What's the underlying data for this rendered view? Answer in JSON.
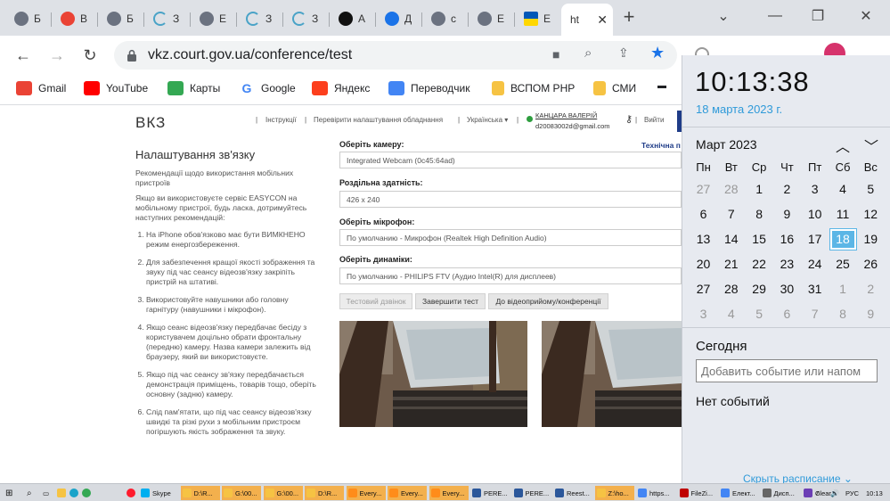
{
  "tabs": [
    {
      "title": "Б",
      "icon": "chrome-icon",
      "color": "#6b7280"
    },
    {
      "title": "В",
      "icon": "gmail-icon",
      "color": "#ea4335"
    },
    {
      "title": "Б",
      "icon": "chrome-icon",
      "color": "#6b7280"
    },
    {
      "title": "З",
      "icon": "loading-icon",
      "color": "#4aa3c7"
    },
    {
      "title": "Е",
      "icon": "chrome-icon",
      "color": "#6b7280"
    },
    {
      "title": "З",
      "icon": "loading-icon",
      "color": "#4aa3c7"
    },
    {
      "title": "З",
      "icon": "loading-icon",
      "color": "#4aa3c7"
    },
    {
      "title": "A",
      "icon": "font-icon",
      "color": "#111111"
    },
    {
      "title": "Д",
      "icon": "d-icon",
      "color": "#1a73e8"
    },
    {
      "title": "с",
      "icon": "chrome-icon",
      "color": "#6b7280"
    },
    {
      "title": "Е",
      "icon": "chrome-icon",
      "color": "#6b7280"
    },
    {
      "title": "Е",
      "icon": "ukraine-flag-icon",
      "color": "#ffd700"
    },
    {
      "title": "ht",
      "icon": "",
      "color": "#ffffff",
      "active": true
    }
  ],
  "address": {
    "url": "vkz.court.gov.ua/conference/test"
  },
  "bookmarks": [
    {
      "label": "Gmail",
      "icon": "gmail-icon",
      "color": "#ea4335"
    },
    {
      "label": "YouTube",
      "icon": "youtube-icon",
      "color": "#ff0000"
    },
    {
      "label": "Карты",
      "icon": "maps-icon",
      "color": "#34a853"
    },
    {
      "label": "Google",
      "icon": "google-icon",
      "color": "#4285f4"
    },
    {
      "label": "Яндекс",
      "icon": "yandex-icon",
      "color": "#fc3f1d"
    },
    {
      "label": "Переводчик",
      "icon": "translate-icon",
      "color": "#4285f4"
    },
    {
      "label": "ВСПОМ PHP",
      "icon": "folder-icon",
      "color": "#f6c343"
    },
    {
      "label": "СМИ",
      "icon": "folder-icon",
      "color": "#f6c343"
    }
  ],
  "site": {
    "logo": "ВКЗ",
    "nav": {
      "instructions": "Інструкції",
      "check_settings": "Перевірити налаштування обладнання",
      "language": "Українська",
      "user_name": "КАНЦАРА ВАЛЕРІЙ",
      "user_email": "d20083002d@gmail.com",
      "logout": "Вийти"
    },
    "heading": "Налаштування зв'язку",
    "rec_title": "Рекомендації щодо використання мобільних пристроїв",
    "rec_intro": "Якщо ви використовуєте сервіс EASYCON на мобільному пристрої, будь ласка, дотримуйтесь наступних рекомендацій:",
    "rec_items": [
      "На iPhone обов'язково має бути ВИМКНЕНО режим енергозбереження.",
      "Для забезпечення кращої якості зображення та звуку під час сеансу відеозв'язку закріпіть пристрій на штативі.",
      "Використовуйте навушники або головну гарнітуру (навушники і мікрофон).",
      "Якщо сеанс відеозв'язку передбачає бесіду з користувачем доцільно обрати фронтальну (передню) камеру. Назва камери залежить від браузеру, який ви використовуєте.",
      "Якщо під час сеансу зв'язку передбачається демонстрація приміщень, товарів тощо, оберіть основну (задню) камеру.",
      "Слід пам'ятати, що під час сеансу відеозв'язку швидкі та різкі рухи з мобільним пристроєм погіршують якість зображення та звуку."
    ],
    "tech_support": "Технічна п",
    "camera_label": "Оберіть камеру:",
    "camera_value": "Integrated Webcam (0c45:64ad)",
    "resolution_label": "Роздільна здатність:",
    "resolution_value": "426 x 240",
    "mic_label": "Оберіть мікрофон:",
    "mic_value": "По умолчанию - Микрофон (Realtek High Definition Audio)",
    "speaker_label": "Оберіть динаміки:",
    "speaker_value": "По умолчанию - PHILIPS FTV (Аудио Intel(R) для дисплеев)",
    "btn_test_call": "Тестовий дзвінок",
    "btn_finish_test": "Завершити тест",
    "btn_to_conference": "До відеоприйому/конференції"
  },
  "calendar": {
    "time": "10:13:38",
    "date": "18 марта 2023 г.",
    "month": "Март 2023",
    "weekdays": [
      "Пн",
      "Вт",
      "Ср",
      "Чт",
      "Пт",
      "Сб",
      "Вс"
    ],
    "days": [
      [
        "27",
        "28",
        "1",
        "2",
        "3",
        "4",
        "5"
      ],
      [
        "6",
        "7",
        "8",
        "9",
        "10",
        "11",
        "12"
      ],
      [
        "13",
        "14",
        "15",
        "16",
        "17",
        "18",
        "19"
      ],
      [
        "20",
        "21",
        "22",
        "23",
        "24",
        "25",
        "26"
      ],
      [
        "27",
        "28",
        "29",
        "30",
        "31",
        "1",
        "2"
      ],
      [
        "3",
        "4",
        "5",
        "6",
        "7",
        "8",
        "9"
      ]
    ],
    "today": "18",
    "today_label": "Сегодня",
    "add_event_placeholder": "Добавить событие или напом",
    "no_events": "Нет событий",
    "hide_schedule": "Скрыть расписание"
  },
  "taskbar": {
    "items": [
      {
        "label": "Skype",
        "color": "#00aff0"
      },
      {
        "label": "D:\\R...",
        "color": "#f6c343"
      },
      {
        "label": "G:\\00...",
        "color": "#f6c343"
      },
      {
        "label": "G:\\00...",
        "color": "#f6c343"
      },
      {
        "label": "D:\\R...",
        "color": "#f6c343"
      },
      {
        "label": "Every...",
        "color": "#ff8c1a"
      },
      {
        "label": "Every...",
        "color": "#ff8c1a"
      },
      {
        "label": "Every...",
        "color": "#ff8c1a"
      },
      {
        "label": "PERE...",
        "color": "#2b579a"
      },
      {
        "label": "PERE...",
        "color": "#2b579a"
      },
      {
        "label": "Reest...",
        "color": "#2b579a"
      },
      {
        "label": "Z:\\ho...",
        "color": "#f6c343"
      },
      {
        "label": "https...",
        "color": "#4285f4"
      },
      {
        "label": "FileZi...",
        "color": "#bf0000"
      },
      {
        "label": "Елект...",
        "color": "#4285f4"
      },
      {
        "label": "Дисп...",
        "color": "#666666"
      },
      {
        "label": "Clear...",
        "color": "#6c3fb5"
      }
    ],
    "lang": "РУС",
    "clock": "10:13"
  },
  "colors": {
    "accent": "#1a73e8",
    "calendar_date": "#2f9ad9",
    "today_bg": "#5bb6e6",
    "bookmark_star": "#1a73e8"
  }
}
